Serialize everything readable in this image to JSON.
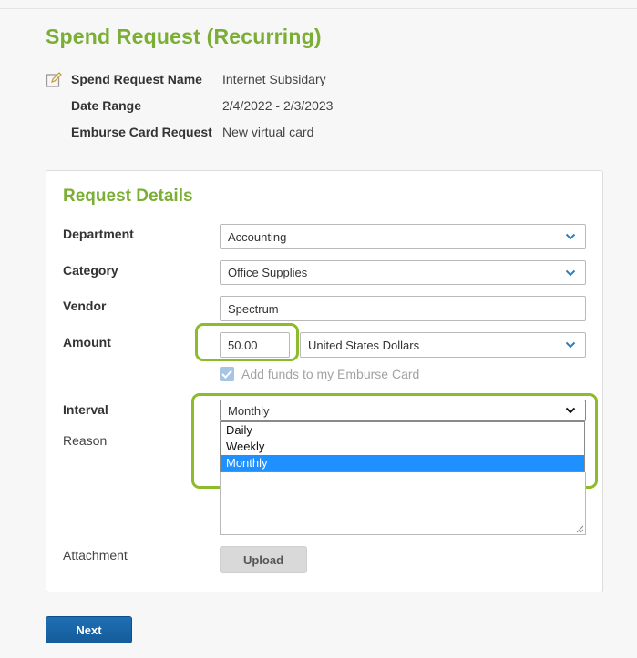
{
  "page": {
    "title": "Spend Request (Recurring)"
  },
  "summary": {
    "rows": [
      {
        "label": "Spend Request Name",
        "value": "Internet Subsidary"
      },
      {
        "label": "Date Range",
        "value": "2/4/2022 - 2/3/2023"
      },
      {
        "label": "Emburse Card Request",
        "value": "New virtual card"
      }
    ],
    "edit_icon": "pencil-edit-icon"
  },
  "details": {
    "title": "Request Details",
    "department": {
      "label": "Department",
      "value": "Accounting"
    },
    "category": {
      "label": "Category",
      "value": "Office Supplies"
    },
    "vendor": {
      "label": "Vendor",
      "value": "Spectrum"
    },
    "amount": {
      "label": "Amount",
      "value": "50.00",
      "currency": "United States Dollars"
    },
    "add_funds": {
      "label": "Add funds to my Emburse Card",
      "checked": true
    },
    "interval": {
      "label": "Interval",
      "value": "Monthly",
      "options": [
        "Daily",
        "Weekly",
        "Monthly"
      ],
      "selected": "Monthly"
    },
    "reason": {
      "label": "Reason",
      "value": ""
    },
    "attachment": {
      "label": "Attachment",
      "button": "Upload"
    }
  },
  "actions": {
    "next": "Next"
  },
  "colors": {
    "accent_green": "#7aae34",
    "highlight_green": "#8cbb2c",
    "primary_blue": "#1a66a8",
    "chevron_blue": "#2b7fc3",
    "selected_option": "#1e90ff"
  }
}
